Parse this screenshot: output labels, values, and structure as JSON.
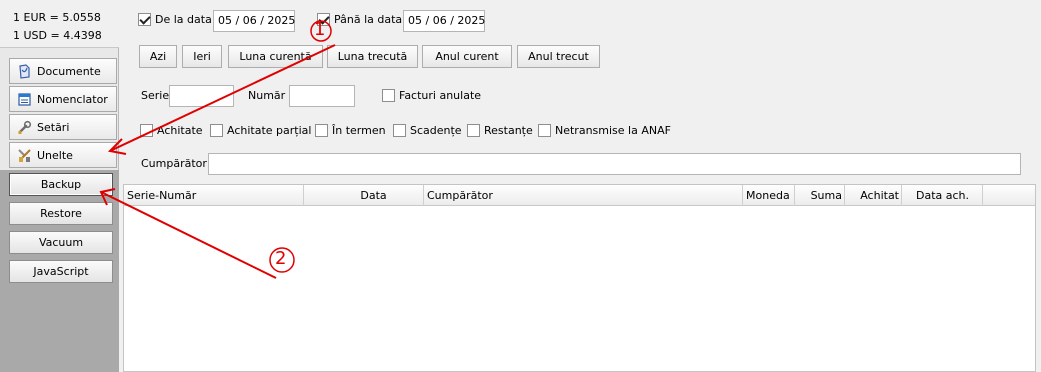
{
  "rates": {
    "eur": "1 EUR = 5.0558",
    "usd": "1 USD = 4.4398"
  },
  "nav": [
    {
      "label": "Documente",
      "icon": "documents-icon"
    },
    {
      "label": "Nomenclator",
      "icon": "nomenclator-icon"
    },
    {
      "label": "Setări",
      "icon": "wrench-icon"
    },
    {
      "label": "Unelte",
      "icon": "tools-icon"
    }
  ],
  "subnav": [
    {
      "label": "Backup",
      "active": true
    },
    {
      "label": "Restore"
    },
    {
      "label": "Vacuum"
    },
    {
      "label": "JavaScript"
    }
  ],
  "filters": {
    "from_label": "De la data",
    "from_value": "05 / 06 / 2025",
    "from_checked": true,
    "to_label": "Până la data",
    "to_value": "05 / 06 / 2025",
    "to_checked": true
  },
  "periods": [
    "Azi",
    "Ieri",
    "Luna curentă",
    "Luna trecută",
    "Anul curent",
    "Anul trecut"
  ],
  "search": {
    "series_label": "Serie",
    "series_value": "",
    "number_label": "Număr",
    "number_value": "",
    "cancelled_label": "Facturi anulate"
  },
  "status_filters": [
    "Achitate",
    "Achitate parțial",
    "În termen",
    "Scadențe",
    "Restanțe",
    "Netransmise la ANAF"
  ],
  "buyer": {
    "label": "Cumpărător",
    "value": ""
  },
  "columns": [
    "Serie-Număr",
    "Data",
    "Cumpărător",
    "Moneda",
    "Suma",
    "Achitat",
    "Data ach."
  ],
  "annotations": {
    "one": "1",
    "two": "2",
    "color": "#e00000"
  }
}
